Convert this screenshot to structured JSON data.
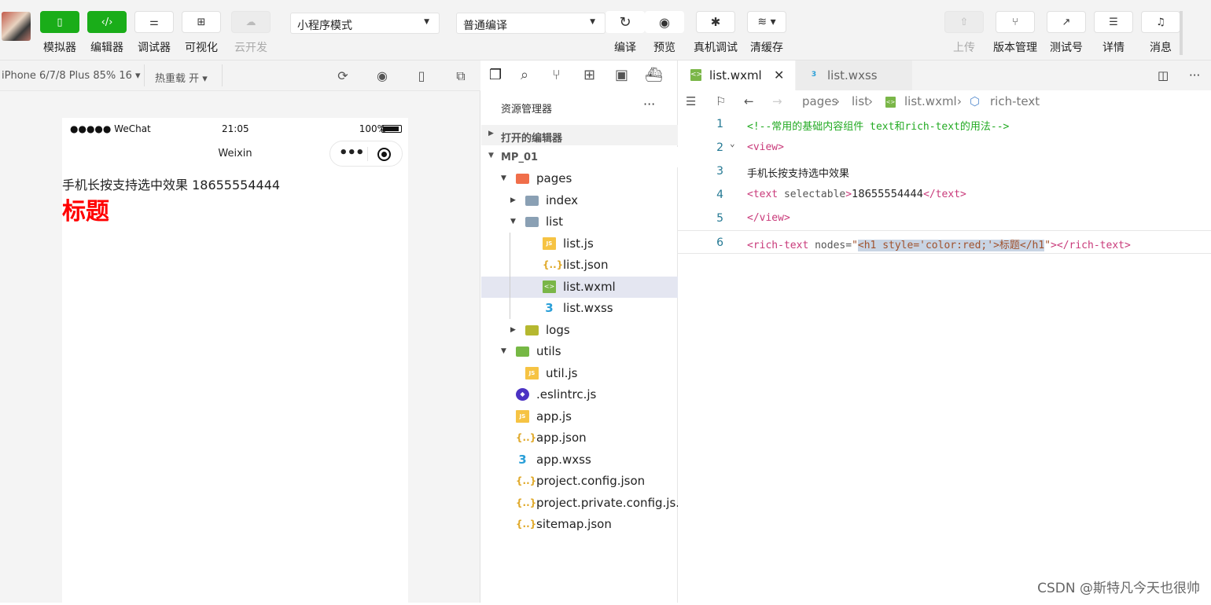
{
  "toolbar": {
    "buttons": [
      {
        "icon": "phone-icon",
        "label": "模拟器"
      },
      {
        "icon": "code-icon",
        "label": "编辑器"
      },
      {
        "icon": "sliders-icon",
        "label": "调试器"
      },
      {
        "icon": "layout-icon",
        "label": "可视化"
      },
      {
        "icon": "cloud-icon",
        "label": "云开发"
      }
    ],
    "mode_select": "小程序模式",
    "compile_select": "普通编译",
    "actions": [
      {
        "icon": "refresh-icon",
        "label": "编译"
      },
      {
        "icon": "eye-icon",
        "label": "预览"
      },
      {
        "icon": "bug-icon",
        "label": "真机调试"
      },
      {
        "icon": "layers-icon",
        "label": "清缓存"
      }
    ],
    "right": [
      {
        "icon": "upload-icon",
        "label": "上传"
      },
      {
        "icon": "branch-icon",
        "label": "版本管理"
      },
      {
        "icon": "external-link-icon",
        "label": "测试号"
      },
      {
        "icon": "menu-icon",
        "label": "详情"
      },
      {
        "icon": "bell-icon",
        "label": "消息"
      }
    ]
  },
  "simulator": {
    "device": "iPhone 6/7/8 Plus 85% 16 ▾",
    "hot_reload": "热重载 开 ▾",
    "status_left": "●●●●● WeChat",
    "status_time": "21:05",
    "status_battery": "100%",
    "nav_title": "Weixin",
    "line1": "手机长按支持选中效果 18655554444",
    "heading": "标题"
  },
  "explorer": {
    "title": "资源管理器",
    "open_editors": "打开的编辑器",
    "project": "MP_01",
    "items": [
      {
        "name": "pages",
        "type": "folder-pages",
        "depth": 1,
        "twisty": "▼"
      },
      {
        "name": "index",
        "type": "folder",
        "depth": 2,
        "twisty": "▶"
      },
      {
        "name": "list",
        "type": "folder-open",
        "depth": 2,
        "twisty": "▼"
      },
      {
        "name": "list.js",
        "type": "js",
        "depth": 3
      },
      {
        "name": "list.json",
        "type": "json",
        "depth": 3
      },
      {
        "name": "list.wxml",
        "type": "wxml",
        "depth": 3,
        "selected": true
      },
      {
        "name": "list.wxss",
        "type": "wxss",
        "depth": 3
      },
      {
        "name": "logs",
        "type": "folder-logs",
        "depth": 2,
        "twisty": "▶"
      },
      {
        "name": "utils",
        "type": "folder-utils",
        "depth": 1,
        "twisty": "▼"
      },
      {
        "name": "util.js",
        "type": "js",
        "depth": 2
      },
      {
        "name": ".eslintrc.js",
        "type": "eslint",
        "depth": 1
      },
      {
        "name": "app.js",
        "type": "js",
        "depth": 1
      },
      {
        "name": "app.json",
        "type": "json",
        "depth": 1
      },
      {
        "name": "app.wxss",
        "type": "wxss",
        "depth": 1
      },
      {
        "name": "project.config.json",
        "type": "json",
        "depth": 1
      },
      {
        "name": "project.private.config.js...",
        "type": "json",
        "depth": 1
      },
      {
        "name": "sitemap.json",
        "type": "json",
        "depth": 1
      }
    ]
  },
  "editor": {
    "tabs": [
      {
        "name": "list.wxml",
        "active": true
      },
      {
        "name": "list.wxss",
        "active": false
      }
    ],
    "breadcrumb": [
      "pages",
      "list",
      "list.wxml",
      "rich-text"
    ],
    "lines": [
      {
        "n": "1",
        "tokens": [
          [
            "c-cmt",
            "<!--常用的基础内容组件 text和rich-text的用法-->"
          ]
        ]
      },
      {
        "n": "2",
        "tokens": [
          [
            "c-tag",
            "<view>"
          ]
        ]
      },
      {
        "n": "3",
        "tokens": [
          [
            "c-txt",
            "手机长按支持选中效果"
          ]
        ]
      },
      {
        "n": "4",
        "tokens": [
          [
            "c-tag",
            "<text "
          ],
          [
            "c-attr",
            "selectable"
          ],
          [
            "c-tag",
            ">"
          ],
          [
            "c-txt",
            "18655554444"
          ],
          [
            "c-tag",
            "</text>"
          ]
        ]
      },
      {
        "n": "5",
        "tokens": [
          [
            "c-tag",
            "</view>"
          ]
        ]
      },
      {
        "n": "6",
        "tokens": [
          [
            "c-tag",
            "<rich-text "
          ],
          [
            "c-attr",
            "nodes="
          ],
          [
            "c-str",
            "\""
          ],
          [
            "c-str hl",
            "<h1 style='color:red;'>标题</h1"
          ],
          [
            "c-str",
            "\""
          ],
          [
            "c-tag",
            "></rich-text>"
          ]
        ]
      }
    ]
  },
  "watermark": "CSDN @斯特凡今天也很帅"
}
